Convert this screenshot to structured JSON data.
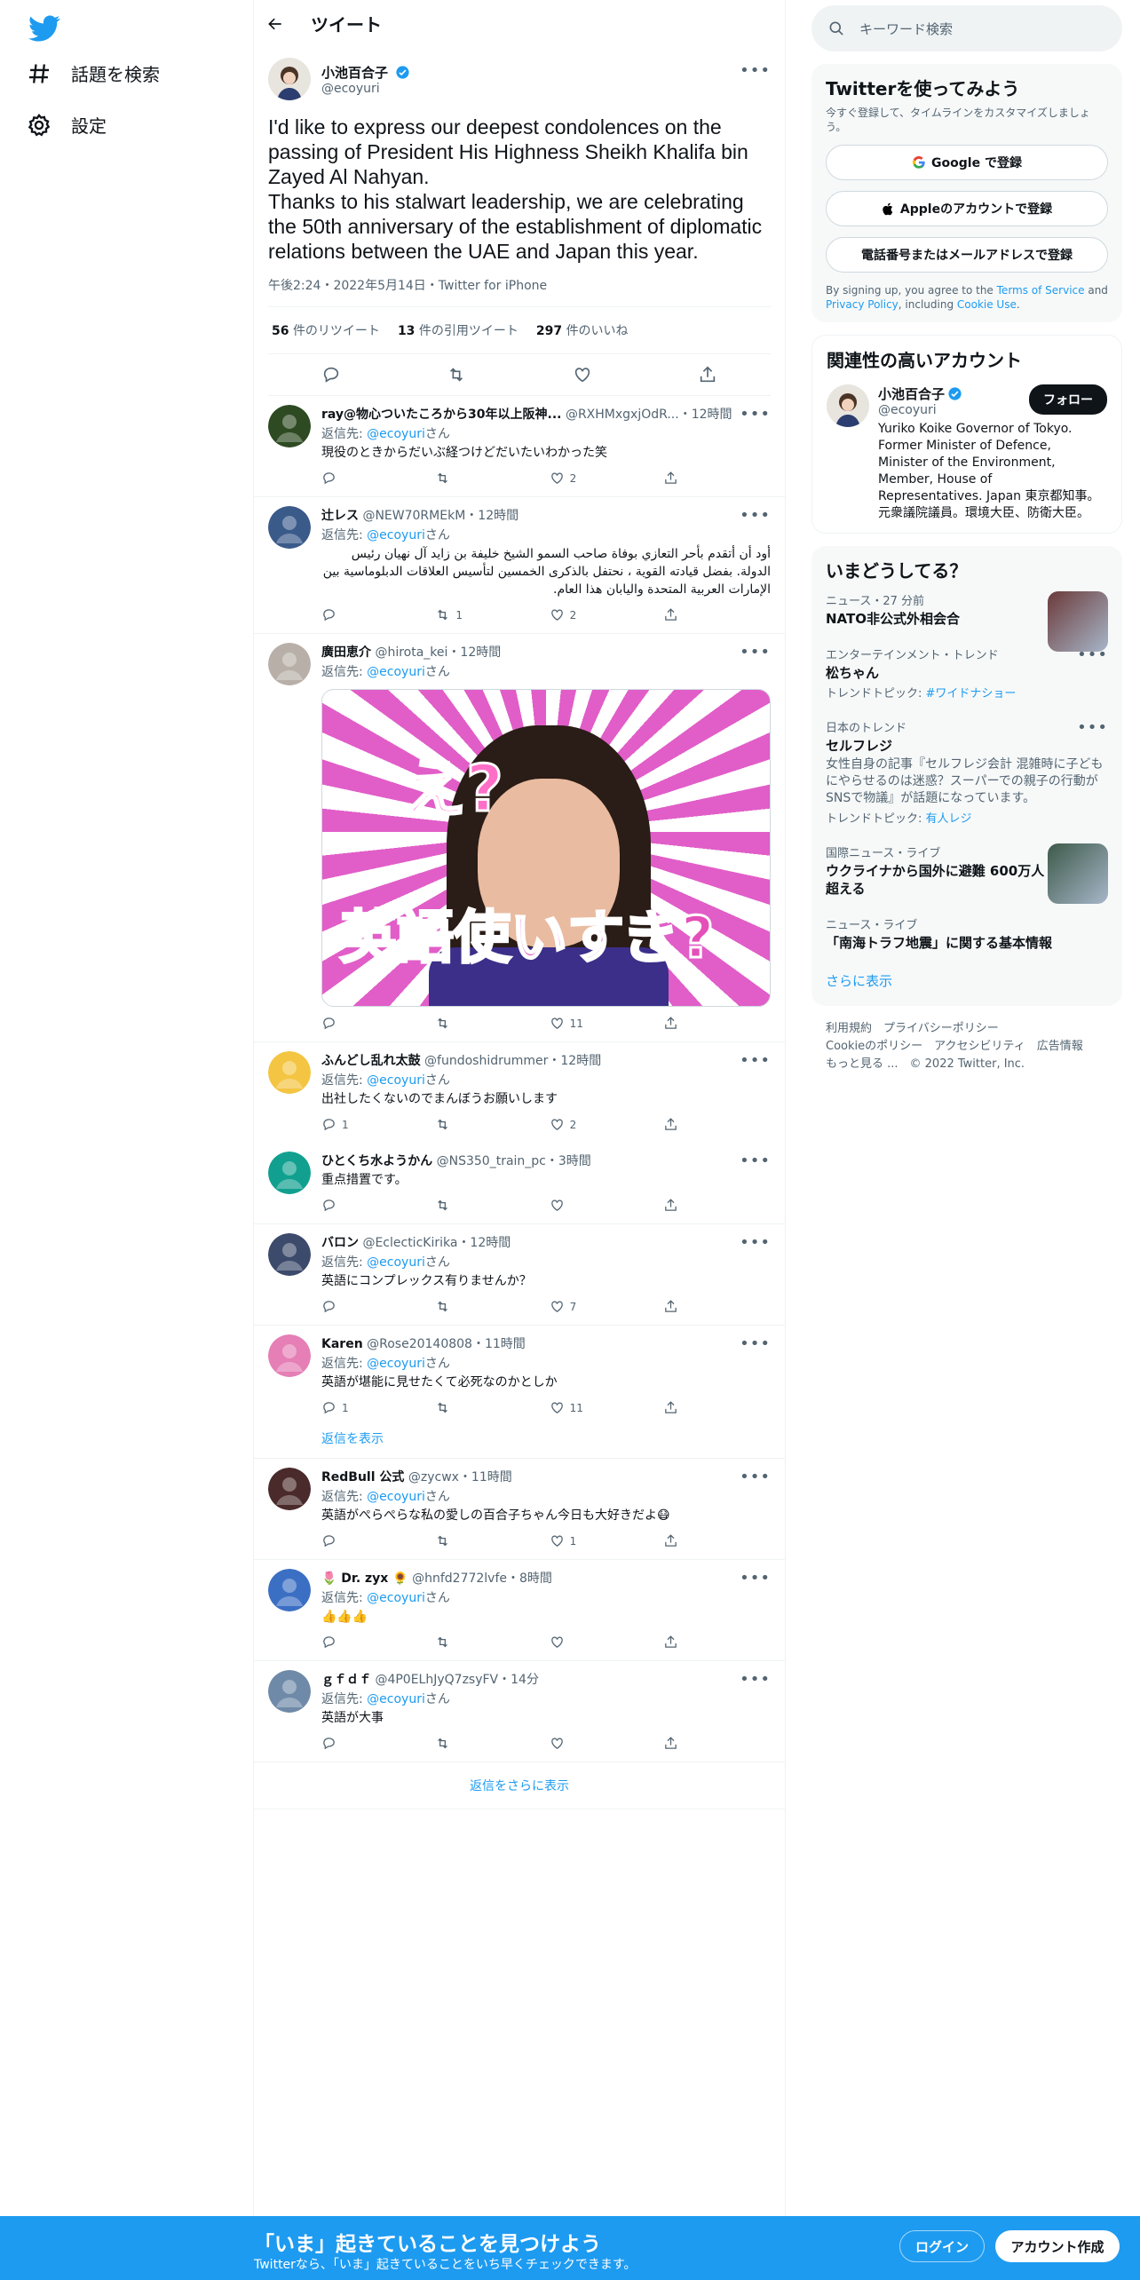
{
  "nav": {
    "explore_label": "話題を検索",
    "settings_label": "設定"
  },
  "header": {
    "title": "ツイート"
  },
  "main_tweet": {
    "name": "小池百合子",
    "handle": "@ecoyuri",
    "text_1": "I'd like to express our deepest condolences on the passing of President His Highness Sheikh Khalifa bin Zayed Al Nahyan.",
    "text_2": "Thanks to his stalwart leadership, we are celebrating the 50th anniversary of the establishment of diplomatic relations between the UAE and Japan this year.",
    "meta": "午後2:24・2022年5月14日・Twitter for iPhone",
    "retweets_count": "56",
    "retweets_label": "件のリツイート",
    "quotes_count": "13",
    "quotes_label": "件の引用ツイート",
    "likes_count": "297",
    "likes_label": "件のいいね"
  },
  "reply_to_prefix": "返信先: ",
  "reply_to_handle": "@ecoyuri",
  "reply_to_suffix": "さん",
  "replies": [
    {
      "name": "ray@物心ついたころから30年以上阪神...",
      "handle": "@RXHMxgxjOdR...",
      "time": "・12時間",
      "text": "現役のときからだいぶ経つけどだいたいわかった笑",
      "retweets": "",
      "likes": "2"
    },
    {
      "name": "辻レス",
      "handle": "@NEW70RMEkM",
      "time": "・12時間",
      "text": "أود أن أتقدم بأحر التعازي بوفاة صاحب السمو الشيخ خليفة بن زايد آل نهيان رئيس الدولة. بفضل قيادته القوية ، نحتفل بالذكرى الخمسين لتأسيس العلاقات الدبلوماسية بين الإمارات العربية المتحدة واليابان هذا العام.",
      "retweets": "1",
      "likes": "2"
    },
    {
      "name": "廣田恵介",
      "handle": "@hirota_kei",
      "time": "・12時間",
      "text": "",
      "retweets": "",
      "likes": "11",
      "image_top": "え?",
      "image_bottom": "英語使いすぎ?"
    },
    {
      "name": "ふんどし乱れ太鼓",
      "handle": "@fundoshidrummer",
      "time": "・12時間",
      "text": "出社したくないのでまんぼうお願いします",
      "replies": "1",
      "retweets": "",
      "likes": "2"
    },
    {
      "name": "ひとくち水ようかん",
      "handle": "@NS350_train_pc",
      "time": "・3時間",
      "text": "重点措置です。",
      "retweets": "",
      "likes": ""
    },
    {
      "name": "バロン",
      "handle": "@EclecticKirika",
      "time": "・12時間",
      "text": "英語にコンプレックス有りませんか？",
      "retweets": "",
      "likes": "7"
    },
    {
      "name": "Karen",
      "handle": "@Rose20140808",
      "time": "・11時間",
      "text": "英語が堪能に見せたくて必死なのかとしか",
      "replies": "1",
      "retweets": "",
      "likes": "11",
      "show_replies": "返信を表示"
    },
    {
      "name": "RedBull 公式",
      "handle": "@zycwx",
      "time": "・11時間",
      "text": "英語がぺらぺらな私の愛しの百合子ちゃん今日も大好きだよ😷",
      "retweets": "",
      "likes": "1"
    },
    {
      "name": "🌷 Dr. zyx 🌻",
      "handle": "@hnfd2772lvfe",
      "time": "・8時間",
      "text": "👍👍👍",
      "retweets": "",
      "likes": ""
    },
    {
      "name": "ｇｆｄｆ",
      "handle": "@4P0ELhJyQ7zsyFV",
      "time": "・14分",
      "text": "英語が大事",
      "retweets": "",
      "likes": ""
    }
  ],
  "more_replies": "返信をさらに表示",
  "search": {
    "placeholder": "キーワード検索"
  },
  "signup": {
    "title": "Twitterを使ってみよう",
    "desc": "今すぐ登録して、タイムラインをカスタマイズしましょう。",
    "google": "Google で登録",
    "apple": "Appleのアカウントで登録",
    "phone": "電話番号またはメールアドレスで登録",
    "terms_prefix": "By signing up, you agree to the ",
    "terms": "Terms of Service",
    "and": " and ",
    "privacy": "Privacy Policy",
    "including": ", including ",
    "cookie": "Cookie Use",
    "period": "."
  },
  "related": {
    "title": "関連性の高いアカウント",
    "name": "小池百合子",
    "handle": "@ecoyuri",
    "follow": "フォロー",
    "bio": "Yuriko Koike Governor of Tokyo. Former Minister of Defence, Minister of the Environment, Member, House of Representatives. Japan 東京都知事。元衆議院議員。環境大臣、防衛大臣。"
  },
  "trends": {
    "title": "いまどうしてる？",
    "items": [
      {
        "cat": "ニュース・27 分前",
        "title": "NATO非公式外相会合",
        "desc": "",
        "topic_label": "",
        "topic": ""
      },
      {
        "cat": "エンターテインメント・トレンド",
        "title": "松ちゃん",
        "desc": "",
        "topic_label": "トレンドトピック: ",
        "topic": "#ワイドナショー"
      },
      {
        "cat": "日本のトレンド",
        "title": "セルフレジ",
        "desc": "女性自身の記事『セルフレジ会計 混雑時に子どもにやらせるのは迷惑？スーパーでの親子の行動がSNSで物議』が話題になっています。",
        "topic_label": "トレンドトピック: ",
        "topic": "有人レジ"
      },
      {
        "cat": "国際ニュース・ライブ",
        "title": "ウクライナから国外に避難 600万人超える",
        "desc": "",
        "topic_label": "",
        "topic": ""
      },
      {
        "cat": "ニュース・ライブ",
        "title": "「南海トラフ地震」に関する基本情報",
        "desc": "",
        "topic_label": "",
        "topic": ""
      }
    ],
    "show_more": "さらに表示"
  },
  "footer": {
    "links_1": "利用規約　プライバシーポリシー",
    "links_2": "Cookieのポリシー　アクセシビリティ　広告情報",
    "links_3": "もっと見る ...　© 2022 Twitter, Inc."
  },
  "bottom": {
    "title": "「いま」起きていることを見つけよう",
    "sub": "Twitterなら、「いま」起きていることをいち早くチェックできます。",
    "login": "ログイン",
    "signup": "アカウント作成"
  },
  "colors": {
    "accent": "#1d9bf0",
    "text": "#0f1419",
    "secondary": "#536471"
  }
}
